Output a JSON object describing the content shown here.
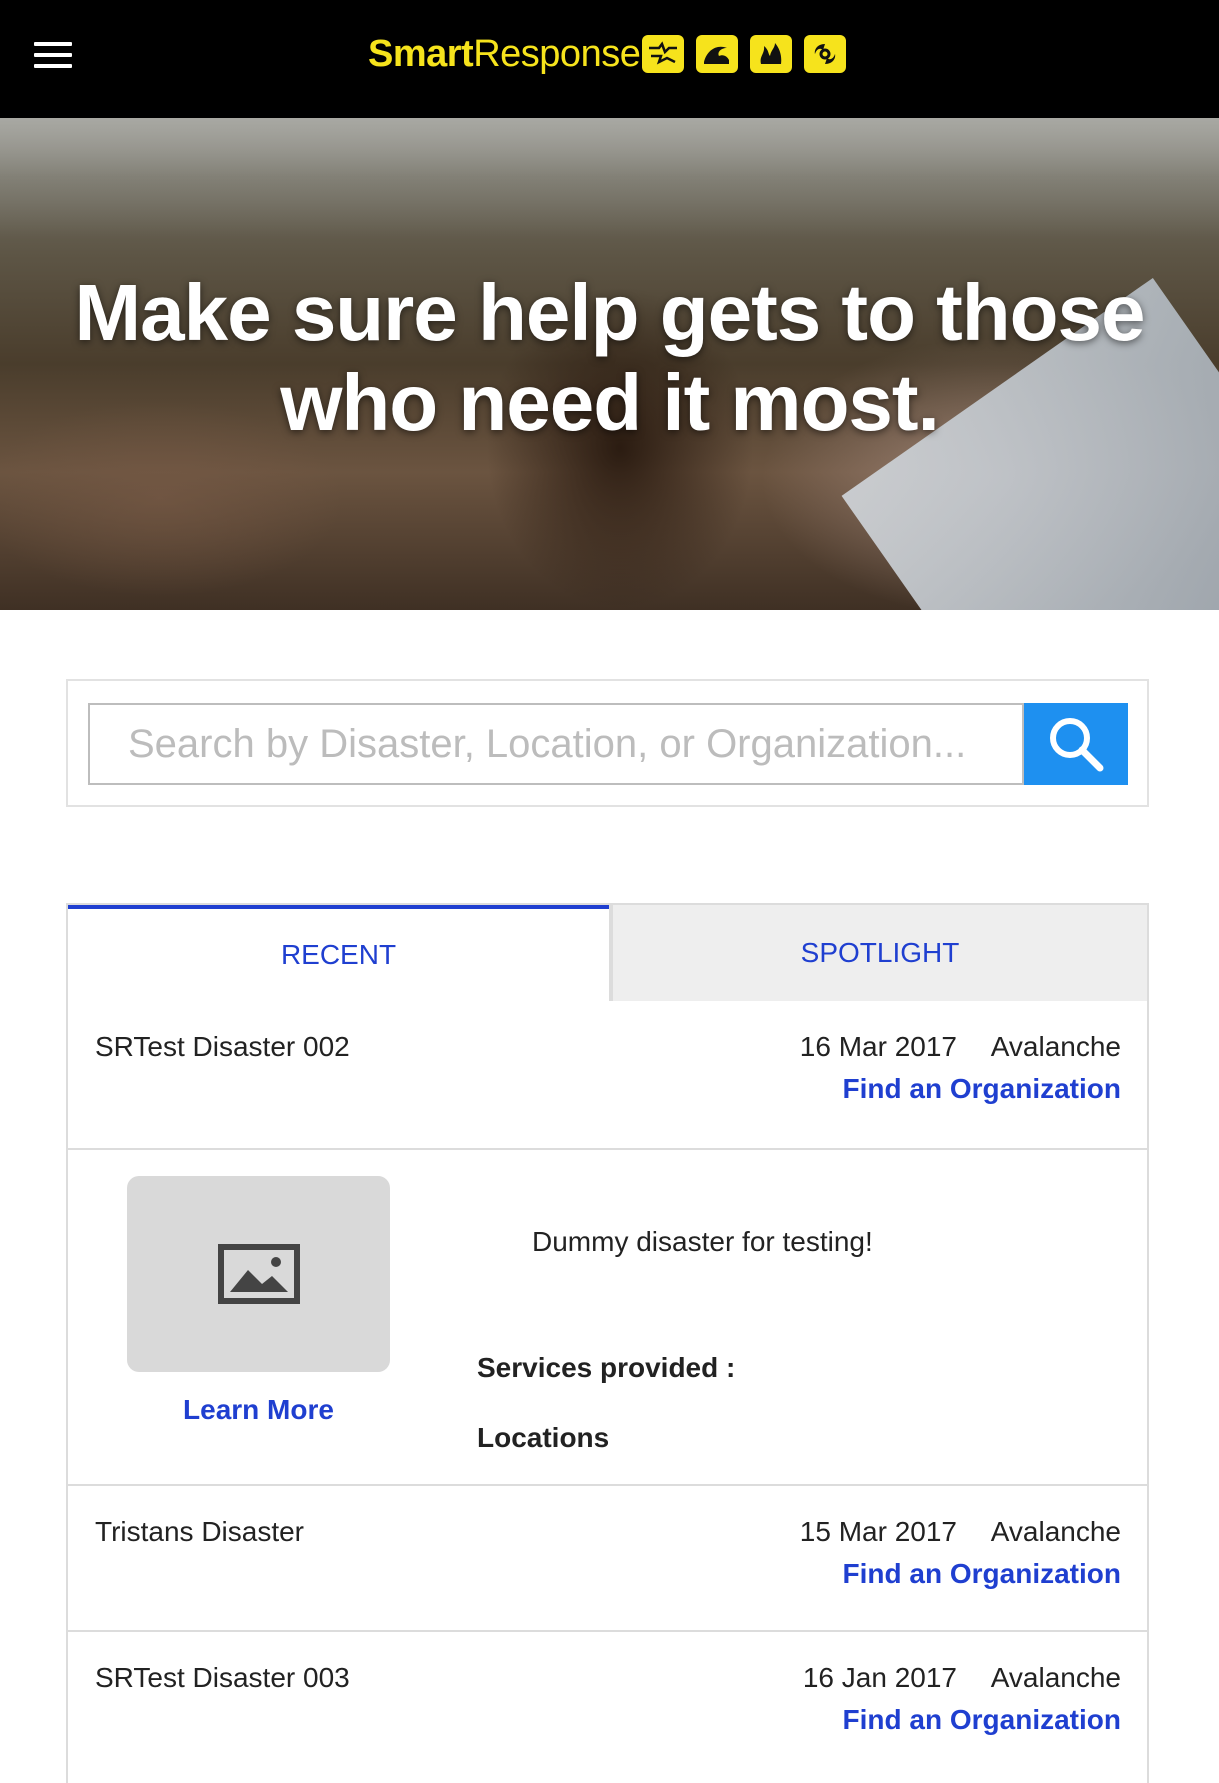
{
  "header": {
    "brand_bold": "Smart",
    "brand_regular": "Response",
    "hazard_icons": [
      "earthquake-icon",
      "flood-wave-icon",
      "wildfire-icon",
      "hurricane-icon"
    ],
    "background_color": "#000000",
    "brand_color": "#f6e31c"
  },
  "hero": {
    "headline_line1": "Make sure help gets to those",
    "headline_line2": "who need it most."
  },
  "search": {
    "placeholder": "Search by Disaster, Location, or Organization...",
    "button_icon": "search-icon",
    "button_color": "#1e90f0"
  },
  "tabs": {
    "recent": "RECENT",
    "spotlight": "SPOTLIGHT",
    "active": "RECENT",
    "accent_color": "#1f3fd0"
  },
  "disasters": [
    {
      "title": "SRTest Disaster 002",
      "date": "16 Mar 2017",
      "type": "Avalanche",
      "link": "Find an Organization"
    },
    {
      "title": "Tristans Disaster",
      "date": "15 Mar 2017",
      "type": "Avalanche",
      "link": "Find an Organization"
    },
    {
      "title": "SRTest Disaster 003",
      "date": "16 Jan 2017",
      "type": "Avalanche",
      "link": "Find an Organization"
    }
  ],
  "expanded": {
    "description": "Dummy disaster for testing!",
    "services_label": "Services provided :",
    "locations_label": "Locations",
    "learn_more": "Learn More",
    "image_icon": "image-placeholder-icon"
  }
}
